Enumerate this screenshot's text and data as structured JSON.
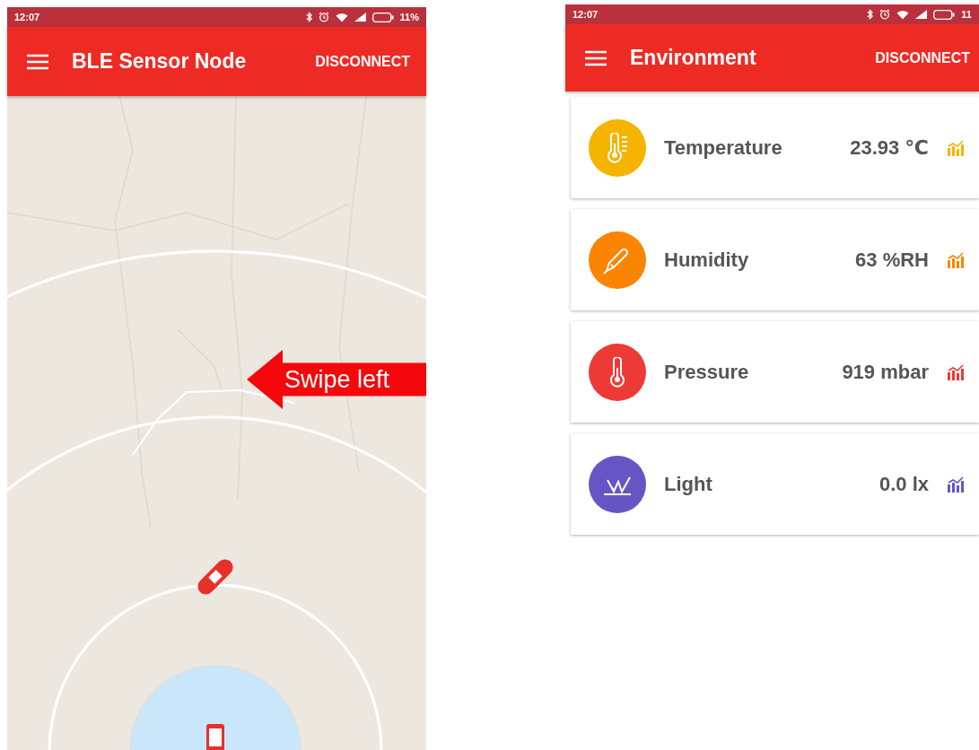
{
  "phones": [
    {
      "status_bar": {
        "time": "12:07",
        "battery": "11%"
      },
      "app_bar": {
        "title": "BLE Sensor Node",
        "action": "DISCONNECT"
      },
      "map": {
        "callout": "Swipe left"
      }
    },
    {
      "status_bar": {
        "time": "12:07",
        "battery": "11"
      },
      "app_bar": {
        "title": "Environment",
        "action": "DISCONNECT"
      },
      "sensors": [
        {
          "kind": "temperature",
          "name": "Temperature",
          "value": "23.93 ℃",
          "color": "#f5b400"
        },
        {
          "kind": "humidity",
          "name": "Humidity",
          "value": "63 %RH",
          "color": "#fb8400"
        },
        {
          "kind": "pressure",
          "name": "Pressure",
          "value": "919 mbar",
          "color": "#ee3a36"
        },
        {
          "kind": "light",
          "name": "Light",
          "value": "0.0 lx",
          "color": "#6655c4"
        }
      ]
    }
  ]
}
